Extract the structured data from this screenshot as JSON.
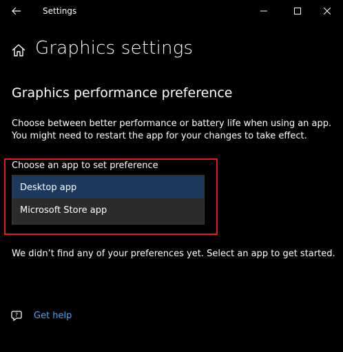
{
  "window": {
    "title": "Settings"
  },
  "header": {
    "page_title": "Graphics settings"
  },
  "section": {
    "title": "Graphics performance preference",
    "description_line1": "Choose between better performance or battery life when using an app.",
    "description_line2": "You might need to restart the app for your changes to take effect."
  },
  "app_picker": {
    "label": "Choose an app to set preference",
    "options": [
      {
        "label": "Desktop app",
        "selected": true
      },
      {
        "label": "Microsoft Store app",
        "selected": false
      }
    ]
  },
  "empty_state": {
    "message": "We didn’t find any of your preferences yet. Select an app to get started."
  },
  "help": {
    "link_label": "Get help"
  },
  "colors": {
    "background": "#000000",
    "accent_link": "#4aa3f0",
    "highlight_border": "#e21b1b",
    "dropdown_bg": "#2b2b2b",
    "dropdown_selected": "#1b3a5e"
  }
}
